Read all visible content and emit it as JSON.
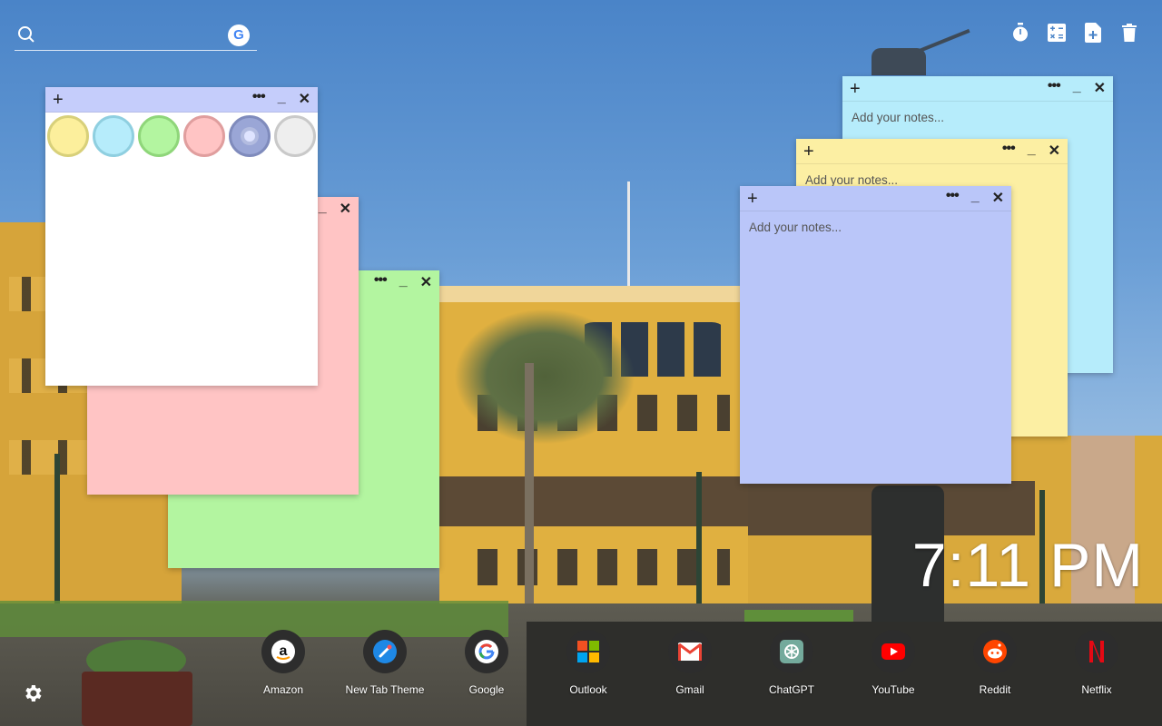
{
  "search": {
    "placeholder": "",
    "icon": "search-icon",
    "engine_badge": "G"
  },
  "toolbar": {
    "items": [
      "timer-icon",
      "calculator-icon",
      "new-note-icon",
      "trash-icon"
    ]
  },
  "notes": [
    {
      "id": "palette-note",
      "color": "#c5cdfb",
      "body_color": "#ffffff"
    },
    {
      "id": "pink-note",
      "color": "#ffc4c4"
    },
    {
      "id": "green-note",
      "color": "#b3f5a0"
    },
    {
      "id": "cyan-note",
      "color": "#b6ecfb",
      "placeholder": "Add your notes..."
    },
    {
      "id": "yellow-note",
      "color": "#fcefa3",
      "placeholder": "Add your notes..."
    },
    {
      "id": "blue-note",
      "color": "#bac6f9",
      "placeholder": "Add your notes..."
    }
  ],
  "note_controls": {
    "add": "+",
    "menu": "•••",
    "minimize": "_",
    "close": "✕"
  },
  "palette": [
    {
      "name": "yellow",
      "fill": "#fcef9c",
      "border": "#d8d07a"
    },
    {
      "name": "cyan",
      "fill": "#b6ecfb",
      "border": "#8fcfe0"
    },
    {
      "name": "green",
      "fill": "#b3f5a0",
      "border": "#8fd67a"
    },
    {
      "name": "pink",
      "fill": "#ffc4c4",
      "border": "#e09e9e"
    },
    {
      "name": "blue",
      "fill": "#9aa6d6",
      "border": "#7f8bbc",
      "selected": true
    },
    {
      "name": "gray",
      "fill": "#eeeeee",
      "border": "#c9c9c9"
    }
  ],
  "clock": {
    "time": "7:11 PM"
  },
  "shortcuts": [
    {
      "label": "Amazon",
      "icon": "amazon-icon"
    },
    {
      "label": "New Tab Theme",
      "icon": "new-tab-theme-icon"
    },
    {
      "label": "Google",
      "icon": "google-icon"
    },
    {
      "label": "Outlook",
      "icon": "outlook-icon"
    },
    {
      "label": "Gmail",
      "icon": "gmail-icon"
    },
    {
      "label": "ChatGPT",
      "icon": "chatgpt-icon"
    },
    {
      "label": "YouTube",
      "icon": "youtube-icon"
    },
    {
      "label": "Reddit",
      "icon": "reddit-icon"
    },
    {
      "label": "Netflix",
      "icon": "netflix-icon"
    }
  ],
  "settings": {
    "icon": "gear-icon"
  }
}
